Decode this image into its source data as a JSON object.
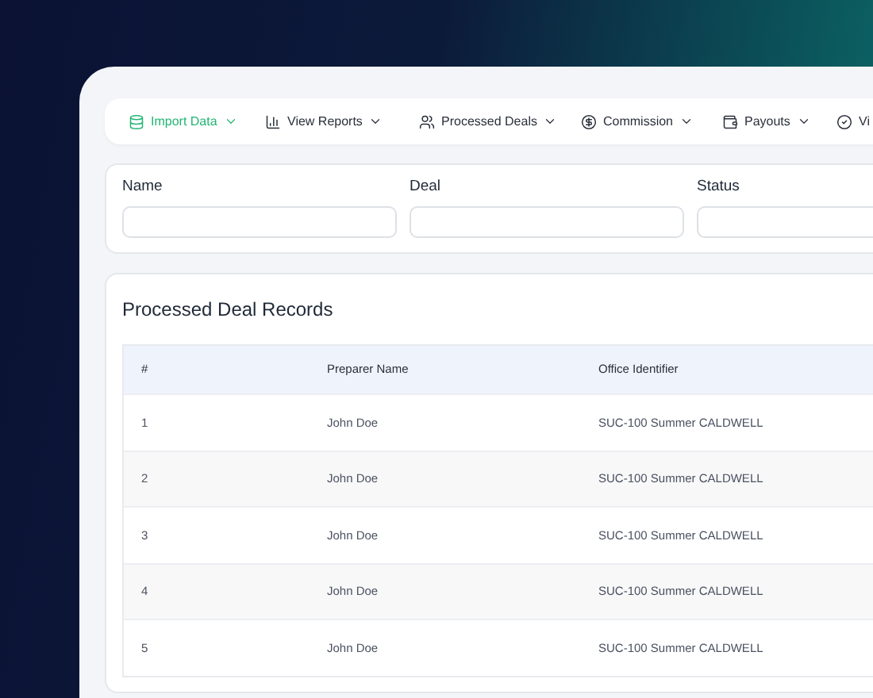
{
  "nav": [
    {
      "label": "Import Data",
      "selected": true
    },
    {
      "label": "View Reports",
      "selected": false
    },
    {
      "label": "Processed Deals",
      "selected": false
    },
    {
      "label": "Commission",
      "selected": false
    },
    {
      "label": "Payouts",
      "selected": false
    },
    {
      "label": "Vi",
      "selected": false
    }
  ],
  "filters": [
    {
      "label": "Name"
    },
    {
      "label": "Deal"
    },
    {
      "label": "Status"
    }
  ],
  "table": {
    "title": "Processed Deal Records",
    "columns": [
      "#",
      "Preparer Name",
      "Office Identifier"
    ],
    "rows": [
      [
        "1",
        "John Doe",
        "SUC-100 Summer CALDWELL"
      ],
      [
        "2",
        "John Doe",
        "SUC-100 Summer CALDWELL"
      ],
      [
        "3",
        "John Doe",
        "SUC-100 Summer CALDWELL"
      ],
      [
        "4",
        "John Doe",
        "SUC-100 Summer CALDWELL"
      ],
      [
        "5",
        "John Doe",
        "SUC-100 Summer CALDWELL"
      ]
    ]
  }
}
